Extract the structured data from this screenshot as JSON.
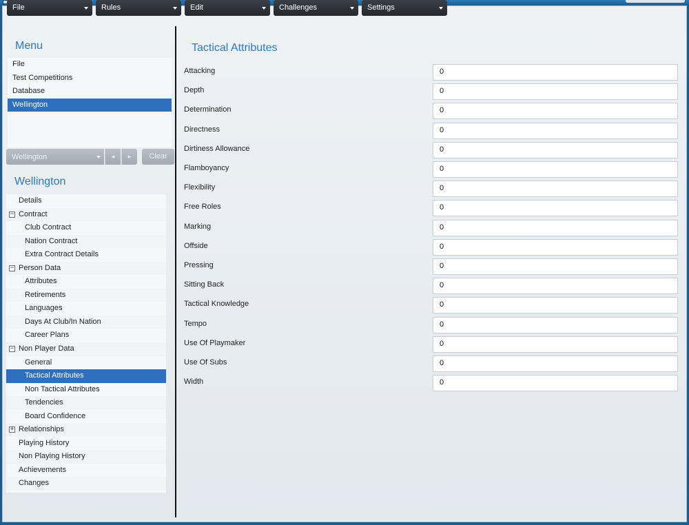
{
  "top_menu": [
    {
      "label": "File"
    },
    {
      "label": "Rules"
    },
    {
      "label": "Edit"
    },
    {
      "label": "Challenges"
    },
    {
      "label": "Settings"
    }
  ],
  "sidebar": {
    "menu_title": "Menu",
    "menu_items": [
      {
        "label": "File"
      },
      {
        "label": "Test Competitions"
      },
      {
        "label": "Database"
      },
      {
        "label": "Wellington",
        "selected": true
      }
    ],
    "selector": {
      "value": "Wellington",
      "prev": "◂",
      "next": "▸",
      "clear_label": "Clear"
    },
    "tree_title": "Wellington",
    "tree": [
      {
        "label": "Details",
        "level": 1
      },
      {
        "label": "Contract",
        "level": 1,
        "expander": "−"
      },
      {
        "label": "Club Contract",
        "level": 2
      },
      {
        "label": "Nation Contract",
        "level": 2
      },
      {
        "label": "Extra Contract Details",
        "level": 2
      },
      {
        "label": "Person Data",
        "level": 1,
        "expander": "−"
      },
      {
        "label": "Attributes",
        "level": 2
      },
      {
        "label": "Retirements",
        "level": 2
      },
      {
        "label": "Languages",
        "level": 2
      },
      {
        "label": "Days At Club/In Nation",
        "level": 2
      },
      {
        "label": "Career Plans",
        "level": 2
      },
      {
        "label": "Non Player Data",
        "level": 1,
        "expander": "−"
      },
      {
        "label": "General",
        "level": 2
      },
      {
        "label": "Tactical Attributes",
        "level": 2,
        "selected": true
      },
      {
        "label": "Non Tactical Attributes",
        "level": 2
      },
      {
        "label": "Tendencies",
        "level": 2
      },
      {
        "label": "Board Confidence",
        "level": 2
      },
      {
        "label": "Relationships",
        "level": 1,
        "expander": "+"
      },
      {
        "label": "Playing History",
        "level": 1
      },
      {
        "label": "Non Playing History",
        "level": 1
      },
      {
        "label": "Achievements",
        "level": 1
      },
      {
        "label": "Changes",
        "level": 1
      }
    ]
  },
  "main": {
    "title": "Tactical Attributes",
    "fields": [
      {
        "label": "Attacking",
        "value": "0"
      },
      {
        "label": "Depth",
        "value": "0"
      },
      {
        "label": "Determination",
        "value": "0"
      },
      {
        "label": "Directness",
        "value": "0"
      },
      {
        "label": "Dirtiness Allowance",
        "value": "0"
      },
      {
        "label": "Flamboyancy",
        "value": "0"
      },
      {
        "label": "Flexibility",
        "value": "0"
      },
      {
        "label": "Free Roles",
        "value": "0"
      },
      {
        "label": "Marking",
        "value": "0"
      },
      {
        "label": "Offside",
        "value": "0"
      },
      {
        "label": "Pressing",
        "value": "0"
      },
      {
        "label": "Sitting Back",
        "value": "0"
      },
      {
        "label": "Tactical Knowledge",
        "value": "0"
      },
      {
        "label": "Tempo",
        "value": "0"
      },
      {
        "label": "Use Of Playmaker",
        "value": "0"
      },
      {
        "label": "Use Of Subs",
        "value": "0"
      },
      {
        "label": "Width",
        "value": "0"
      }
    ]
  },
  "colors": {
    "accent": "#2b79c0",
    "selection": "#2f6fc0",
    "menu_button": "#2e3338"
  }
}
